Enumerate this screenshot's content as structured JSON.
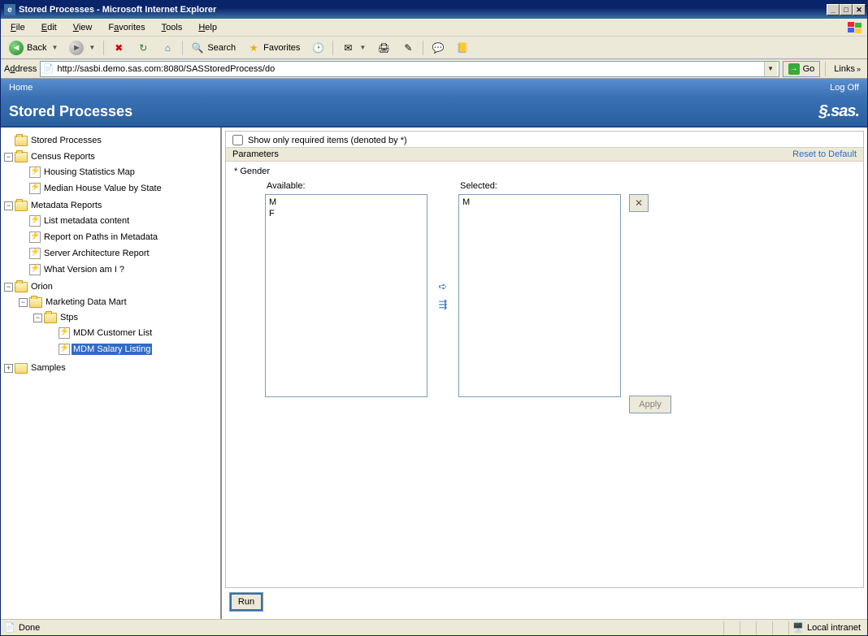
{
  "titlebar": {
    "text": "Stored Processes - Microsoft Internet Explorer"
  },
  "menubar": {
    "items": [
      "File",
      "Edit",
      "View",
      "Favorites",
      "Tools",
      "Help"
    ]
  },
  "toolbar": {
    "back": "Back",
    "search": "Search",
    "favorites": "Favorites"
  },
  "addressbar": {
    "label": "Address",
    "url": "http://sasbi.demo.sas.com:8080/SASStoredProcess/do",
    "go": "Go",
    "links": "Links"
  },
  "sas_header": {
    "home": "Home",
    "logoff": "Log Off",
    "title": "Stored Processes",
    "brand": "SAS"
  },
  "tree": {
    "root": "Stored Processes",
    "census": {
      "label": "Census Reports",
      "items": [
        "Housing Statistics Map",
        "Median House Value by State"
      ]
    },
    "metadata": {
      "label": "Metadata Reports",
      "items": [
        "List metadata content",
        "Report on Paths in Metadata",
        "Server Architecture Report",
        "What Version am I ?"
      ]
    },
    "orion": {
      "label": "Orion",
      "mdm": "Marketing Data Mart",
      "stps": "Stps",
      "stps_items": [
        "MDM Customer List",
        "MDM Salary Listing"
      ]
    },
    "samples": "Samples"
  },
  "content": {
    "show_required": "Show only required items (denoted by *)",
    "params_label": "Parameters",
    "reset": "Reset to Default",
    "param_name": "* Gender",
    "available_label": "Available:",
    "selected_label": "Selected:",
    "available_options": [
      "M",
      "F"
    ],
    "selected_options": [
      "M"
    ],
    "apply": "Apply",
    "run": "Run"
  },
  "statusbar": {
    "done": "Done",
    "zone": "Local intranet"
  }
}
